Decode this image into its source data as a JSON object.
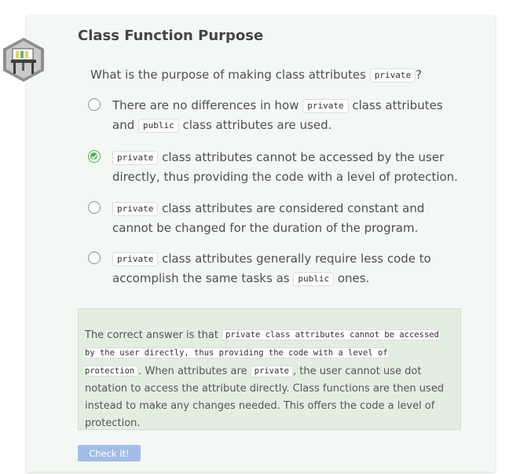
{
  "title": "Class Function Purpose",
  "question": {
    "before": "What is the purpose of making class attributes ",
    "code": "private",
    "after": "?"
  },
  "options": [
    {
      "selected": false,
      "parts": [
        {
          "t": "text",
          "v": "There are no differences in how "
        },
        {
          "t": "code",
          "v": "private"
        },
        {
          "t": "text",
          "v": " class attributes and "
        },
        {
          "t": "code",
          "v": "public"
        },
        {
          "t": "text",
          "v": " class attributes are used."
        }
      ]
    },
    {
      "selected": true,
      "parts": [
        {
          "t": "code",
          "v": "private"
        },
        {
          "t": "text",
          "v": " class attributes cannot be accessed by the user directly, thus providing the code with a level of protection."
        }
      ]
    },
    {
      "selected": false,
      "parts": [
        {
          "t": "code",
          "v": "private"
        },
        {
          "t": "text",
          "v": " class attributes are considered constant and cannot be changed for the duration of the program."
        }
      ]
    },
    {
      "selected": false,
      "parts": [
        {
          "t": "code",
          "v": "private"
        },
        {
          "t": "text",
          "v": " class attributes generally require less code to accomplish the same tasks as "
        },
        {
          "t": "code",
          "v": "public"
        },
        {
          "t": "text",
          "v": " ones."
        }
      ]
    }
  ],
  "explanation": {
    "p1": "The correct answer is that ",
    "code1": "private class attributes cannot be accessed by the user directly, thus providing the code with a level of protection",
    "p2": ". When attributes are ",
    "code2": "private",
    "p3": ", the user cannot use dot notation to access the attribute directly. Class functions are then used instead to make any changes needed. This offers the code a level of protection."
  },
  "button": {
    "label": "Check It!"
  },
  "colors": {
    "accent_green": "#4caf50",
    "button_blue": "#a3bde6",
    "card_bg": "#f4f8f4",
    "explain_bg": "#e3eee3"
  },
  "badge_icon": "classroom-badge-icon"
}
